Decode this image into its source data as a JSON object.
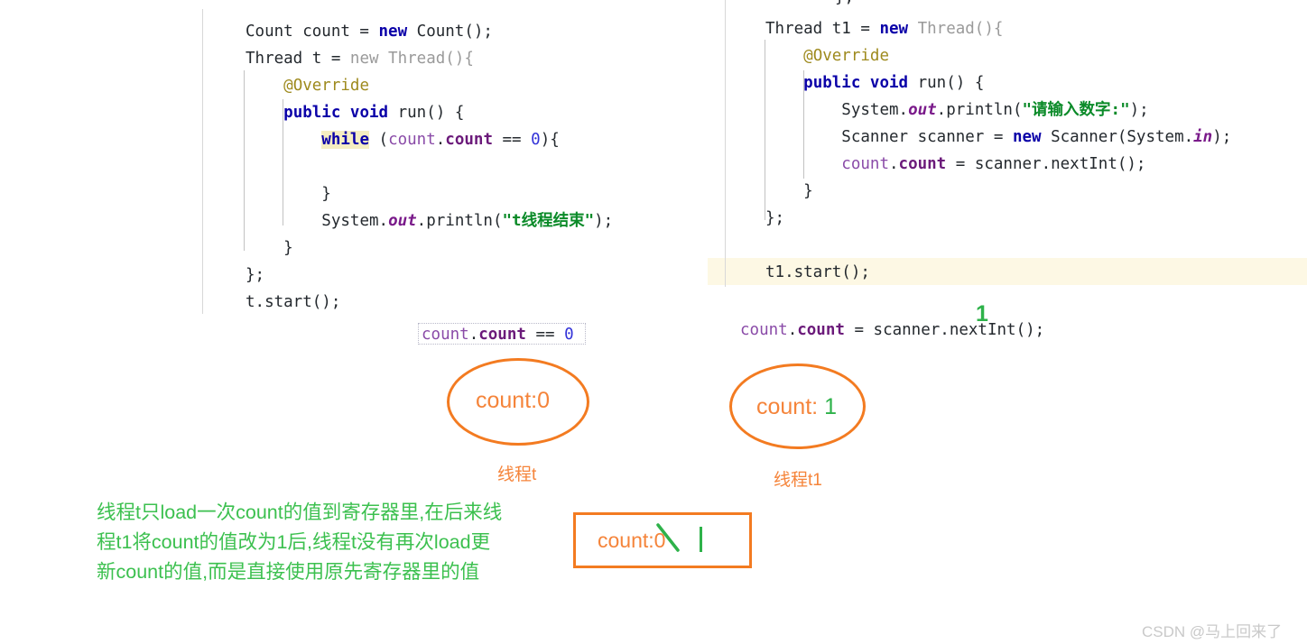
{
  "colors": {
    "orange": "#f37b21",
    "orange_text": "#f5843a",
    "green_ink": "#2eb24a",
    "green_note": "#3cc04f",
    "highlight_band": "#fdf8e4",
    "keyword_highlight": "#f5eec2",
    "watermark": "#c9c9c9"
  },
  "left_code": {
    "lines": [
      {
        "indent": 0,
        "tokens": [
          {
            "text": "Count count = ",
            "cls": "t-plain"
          },
          {
            "text": "new",
            "cls": "t-kw"
          },
          {
            "text": " Count();",
            "cls": "t-plain"
          }
        ]
      },
      {
        "indent": 0,
        "tokens": [
          {
            "text": "Thread t = ",
            "cls": "t-plain"
          },
          {
            "text": "new",
            "cls": "t-kw-soft"
          },
          {
            "text": " Thread(){",
            "cls": "t-kw-soft"
          }
        ]
      },
      {
        "indent": 1,
        "tokens": [
          {
            "text": "@Override",
            "cls": "t-anno"
          }
        ]
      },
      {
        "indent": 1,
        "tokens": [
          {
            "text": "public void",
            "cls": "t-kw"
          },
          {
            "text": " run() {",
            "cls": "t-plain"
          }
        ]
      },
      {
        "indent": 2,
        "tokens": [
          {
            "text": "while",
            "cls": "t-kw t-hl"
          },
          {
            "text": " (",
            "cls": "t-plain"
          },
          {
            "text": "count",
            "cls": "t-field"
          },
          {
            "text": ".",
            "cls": "t-plain"
          },
          {
            "text": "count",
            "cls": "t-field-b"
          },
          {
            "text": " == ",
            "cls": "t-plain"
          },
          {
            "text": "0",
            "cls": "t-num"
          },
          {
            "text": "){",
            "cls": "t-plain"
          }
        ]
      },
      {
        "indent": 0,
        "tokens": [
          {
            "text": "",
            "cls": "t-plain"
          }
        ]
      },
      {
        "indent": 2,
        "tokens": [
          {
            "text": "}",
            "cls": "t-plain"
          }
        ]
      },
      {
        "indent": 2,
        "tokens": [
          {
            "text": "System.",
            "cls": "t-plain"
          },
          {
            "text": "out",
            "cls": "t-static"
          },
          {
            "text": ".println(",
            "cls": "t-plain"
          },
          {
            "text": "\"t线程结束\"",
            "cls": "t-str"
          },
          {
            "text": ");",
            "cls": "t-plain"
          }
        ]
      },
      {
        "indent": 1,
        "tokens": [
          {
            "text": "}",
            "cls": "t-plain"
          }
        ]
      },
      {
        "indent": 0,
        "tokens": [
          {
            "text": "};",
            "cls": "t-plain"
          }
        ]
      },
      {
        "indent": 0,
        "tokens": [
          {
            "text": "t.start();",
            "cls": "t-plain"
          }
        ]
      }
    ]
  },
  "right_code": {
    "lines": [
      {
        "indent": 0,
        "tokens": [
          {
            "text": "Thread t1 = ",
            "cls": "t-plain"
          },
          {
            "text": "new",
            "cls": "t-kw"
          },
          {
            "text": " Thread(){",
            "cls": "t-kw-soft"
          }
        ]
      },
      {
        "indent": 1,
        "tokens": [
          {
            "text": "@Override",
            "cls": "t-anno"
          }
        ]
      },
      {
        "indent": 1,
        "tokens": [
          {
            "text": "public void",
            "cls": "t-kw"
          },
          {
            "text": " run() {",
            "cls": "t-plain"
          }
        ]
      },
      {
        "indent": 2,
        "tokens": [
          {
            "text": "System.",
            "cls": "t-plain"
          },
          {
            "text": "out",
            "cls": "t-static"
          },
          {
            "text": ".println(",
            "cls": "t-plain"
          },
          {
            "text": "\"请输入数字:\"",
            "cls": "t-str"
          },
          {
            "text": ");",
            "cls": "t-plain"
          }
        ]
      },
      {
        "indent": 2,
        "tokens": [
          {
            "text": "Scanner scanner = ",
            "cls": "t-plain"
          },
          {
            "text": "new",
            "cls": "t-kw"
          },
          {
            "text": " Scanner(System.",
            "cls": "t-plain"
          },
          {
            "text": "in",
            "cls": "t-static"
          },
          {
            "text": ");",
            "cls": "t-plain"
          }
        ]
      },
      {
        "indent": 2,
        "tokens": [
          {
            "text": "count",
            "cls": "t-field"
          },
          {
            "text": ".",
            "cls": "t-plain"
          },
          {
            "text": "count",
            "cls": "t-field-b"
          },
          {
            "text": " = scanner.nextInt();",
            "cls": "t-plain"
          }
        ]
      },
      {
        "indent": 1,
        "tokens": [
          {
            "text": "}",
            "cls": "t-plain"
          }
        ]
      },
      {
        "indent": 0,
        "tokens": [
          {
            "text": "};",
            "cls": "t-plain"
          }
        ]
      },
      {
        "indent": 0,
        "tokens": [
          {
            "text": "",
            "cls": "t-plain"
          }
        ]
      },
      {
        "indent": 0,
        "tokens": [
          {
            "text": "t1.start();",
            "cls": "t-plain"
          }
        ]
      }
    ]
  },
  "snippets": {
    "left_condition": [
      {
        "text": "count",
        "cls": "t-field"
      },
      {
        "text": ".",
        "cls": "t-plain"
      },
      {
        "text": "count",
        "cls": "t-field-b"
      },
      {
        "text": " == ",
        "cls": "t-plain"
      },
      {
        "text": "0",
        "cls": "t-num"
      }
    ],
    "right_assignment": [
      {
        "text": "count",
        "cls": "t-field"
      },
      {
        "text": ".",
        "cls": "t-plain"
      },
      {
        "text": "count",
        "cls": "t-field-b"
      },
      {
        "text": " = scanner.nextInt();",
        "cls": "t-plain"
      }
    ],
    "right_ink_digit": "1"
  },
  "ellipses": [
    {
      "value_label": "count:0",
      "ink_value": "",
      "thread_label": "线程t"
    },
    {
      "value_label": "count: ",
      "ink_value": "1",
      "thread_label": "线程t1"
    }
  ],
  "note": {
    "line1": "线程t只load一次count的值到寄存器里,在后来线",
    "line2": "程t1将count的值改为1后,线程t没有再次load更",
    "line3": "新count的值,而是直接使用原先寄存器里的值"
  },
  "value_box": {
    "text": "count:0",
    "struck_char": "0"
  },
  "watermark": {
    "text": "CSDN @马上回来了"
  }
}
